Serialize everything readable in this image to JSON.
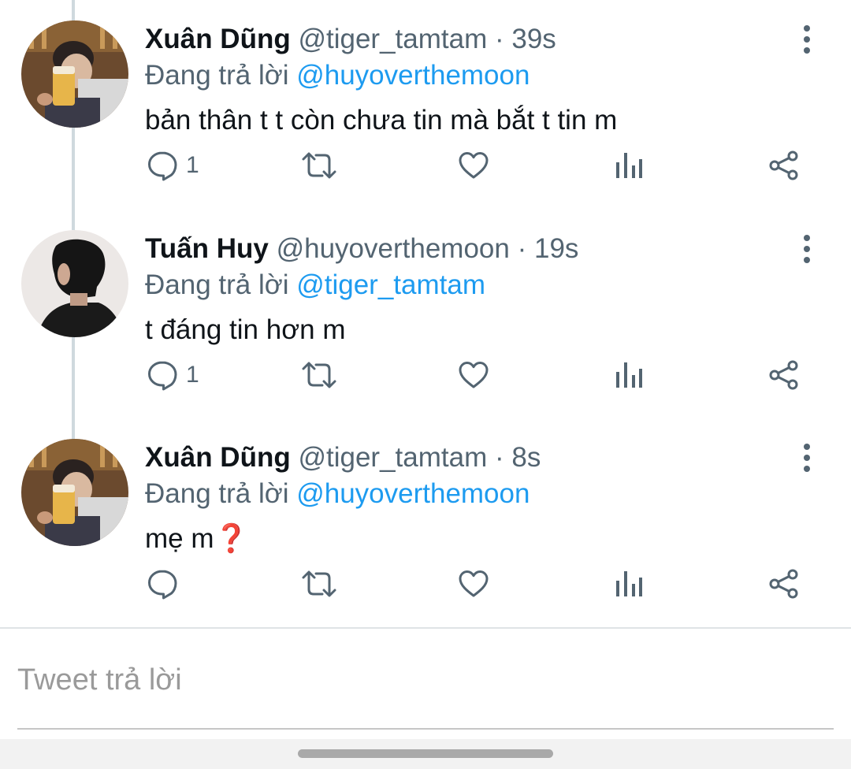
{
  "tweets": [
    {
      "name": "Xuân Dũng",
      "handle": "@tiger_tamtam",
      "separator": "·",
      "time": "39s",
      "replying_prefix": "Đang trả lời",
      "replying_to": "@huyoverthemoon",
      "text": "bản thân t t còn chưa tin mà bắt t tin m",
      "reply_count": "1",
      "avatar": "beer-photo-avatar"
    },
    {
      "name": "Tuấn Huy",
      "handle": "@huyoverthemoon",
      "separator": "·",
      "time": "19s",
      "replying_prefix": "Đang trả lời",
      "replying_to": "@tiger_tamtam",
      "text": "t đáng tin hơn m",
      "reply_count": "1",
      "avatar": "profile-silhouette-avatar"
    },
    {
      "name": "Xuân Dũng",
      "handle": "@tiger_tamtam",
      "separator": "·",
      "time": "8s",
      "replying_prefix": "Đang trả lời",
      "replying_to": "@huyoverthemoon",
      "text": "mẹ m❓",
      "reply_count": "",
      "avatar": "beer-photo-avatar"
    }
  ],
  "reply_box": {
    "placeholder": "Tweet trả lời"
  },
  "icons": {
    "reply": "reply-icon",
    "retweet": "retweet-icon",
    "like": "heart-icon",
    "analytics": "analytics-icon",
    "share": "share-icon",
    "more": "more-vertical-icon"
  },
  "colors": {
    "text": "#0f1419",
    "secondary": "#536471",
    "accent": "#1d9bf0",
    "thread_line": "#cfd9de"
  }
}
